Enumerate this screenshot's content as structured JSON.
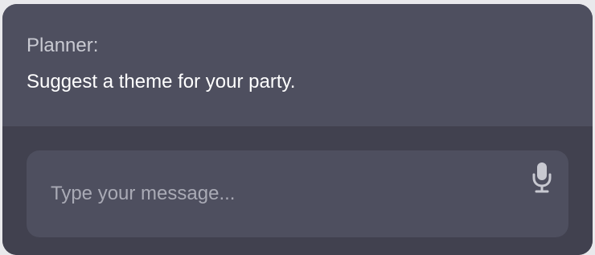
{
  "chat": {
    "speaker": "Planner:",
    "message": "Suggest a theme for your party."
  },
  "composer": {
    "placeholder": "Type your message...",
    "value": "",
    "mic_icon": "microphone-icon"
  },
  "colors": {
    "panel": "#4e4f5f",
    "background": "#41414f",
    "text": "#ffffff",
    "muted_text": "#c9cad2",
    "placeholder": "#a9aab5",
    "icon": "#c8c9d1"
  }
}
